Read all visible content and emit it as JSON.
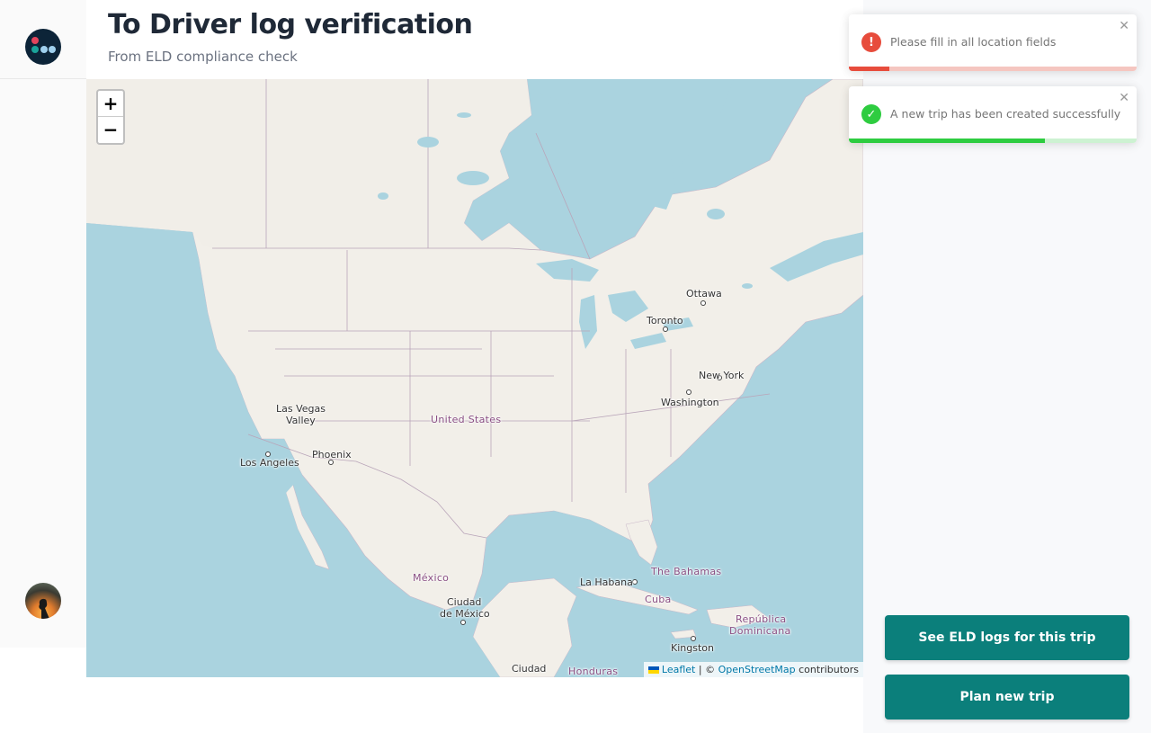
{
  "header": {
    "title": "To Driver log verification",
    "subtitle": "From ELD compliance check"
  },
  "sidebar": {
    "logo_icon": "app-logo-icon",
    "avatar_icon": "user-avatar-icon"
  },
  "map": {
    "zoom_in": "+",
    "zoom_out": "−",
    "labels": {
      "ottawa": "Ottawa",
      "toronto": "Toronto",
      "new_york": "New York",
      "washington": "Washington",
      "las_vegas_1": "Las Vegas",
      "las_vegas_2": "Valley",
      "phoenix": "Phoenix",
      "los_angeles": "Los Angeles",
      "united_states": "United States",
      "mexico": "México",
      "ciudad_mexico_1": "Ciudad",
      "ciudad_mexico_2": "de México",
      "la_habana": "La Habana",
      "cuba": "Cuba",
      "bahamas": "The Bahamas",
      "republica_1": "República",
      "republica_2": "Dominicana",
      "kingston": "Kingston",
      "ciudad_bottom": "Ciudad",
      "honduras": "Honduras"
    },
    "attribution": {
      "leaflet": "Leaflet",
      "separator": " | © ",
      "osm": "OpenStreetMap",
      "suffix": " contributors"
    }
  },
  "toasts": [
    {
      "type": "error",
      "icon": "error-icon",
      "message": "Please fill in all location fields",
      "color": "#e74c3c",
      "progress": 0.14
    },
    {
      "type": "success",
      "icon": "check-circle-icon",
      "message": "A new trip has been created successfully",
      "color": "#2ecc40",
      "progress": 0.68
    }
  ],
  "actions": {
    "see_logs": "See ELD logs for this trip",
    "plan_trip": "Plan new trip"
  },
  "colors": {
    "accent": "#0b7f7b",
    "error": "#e74c3c",
    "success": "#2ecc40",
    "water": "#aad3df",
    "land": "#f2efe9"
  }
}
